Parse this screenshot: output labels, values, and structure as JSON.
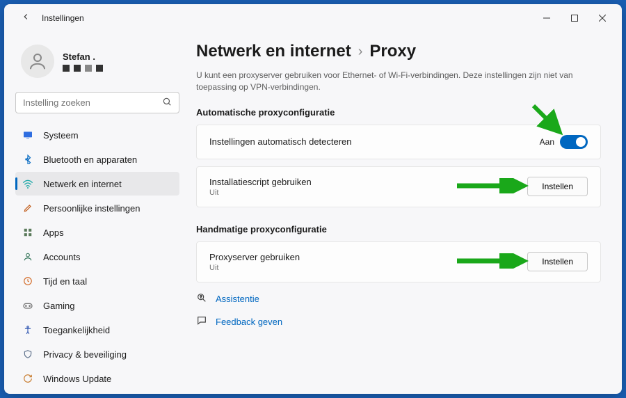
{
  "window": {
    "title": "Instellingen"
  },
  "profile": {
    "name": "Stefan ."
  },
  "search": {
    "placeholder": "Instelling zoeken"
  },
  "nav": {
    "items": [
      {
        "label": "Systeem"
      },
      {
        "label": "Bluetooth en apparaten"
      },
      {
        "label": "Netwerk en internet"
      },
      {
        "label": "Persoonlijke instellingen"
      },
      {
        "label": "Apps"
      },
      {
        "label": "Accounts"
      },
      {
        "label": "Tijd en taal"
      },
      {
        "label": "Gaming"
      },
      {
        "label": "Toegankelijkheid"
      },
      {
        "label": "Privacy & beveiliging"
      },
      {
        "label": "Windows Update"
      }
    ]
  },
  "breadcrumb": {
    "parent": "Netwerk en internet",
    "current": "Proxy"
  },
  "page": {
    "description": "U kunt een proxyserver gebruiken voor Ethernet- of Wi-Fi-verbindingen. Deze instellingen zijn niet van toepassing op VPN-verbindingen."
  },
  "sections": {
    "auto": {
      "title": "Automatische proxyconfiguratie",
      "detect": {
        "label": "Instellingen automatisch detecteren",
        "state": "Aan"
      },
      "script": {
        "label": "Installatiescript gebruiken",
        "state": "Uit",
        "button": "Instellen"
      }
    },
    "manual": {
      "title": "Handmatige proxyconfiguratie",
      "proxy": {
        "label": "Proxyserver gebruiken",
        "state": "Uit",
        "button": "Instellen"
      }
    }
  },
  "links": {
    "help": "Assistentie",
    "feedback": "Feedback geven"
  }
}
